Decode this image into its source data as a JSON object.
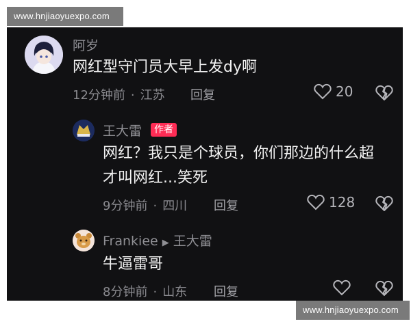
{
  "watermark": {
    "text": "www.hnjiaoyuexpo.com"
  },
  "comments": [
    {
      "user": "阿岁",
      "text": "网红型守门员大早上发dy啊",
      "time": "12分钟前",
      "location": "江苏",
      "reply_label": "回复",
      "likes": "20"
    },
    {
      "user": "王大雷",
      "badge": "作者",
      "text_line1": "网红？我只是个球员，你们那边的什么超",
      "text_line2": "才叫网红...笑死",
      "time": "9分钟前",
      "location": "四川",
      "reply_label": "回复",
      "likes": "128"
    },
    {
      "user": "Frankiee",
      "reply_to": "王大雷",
      "text": "牛逼雷哥",
      "time": "8分钟前",
      "location": "山东",
      "reply_label": "回复"
    }
  ],
  "colors": {
    "background": "#111113",
    "badge": "#fe2c55",
    "text": "#f2f2f2",
    "muted": "#8a8a8f"
  },
  "icons": [
    "heart-icon",
    "broken-heart-icon",
    "play-arrow-icon"
  ]
}
